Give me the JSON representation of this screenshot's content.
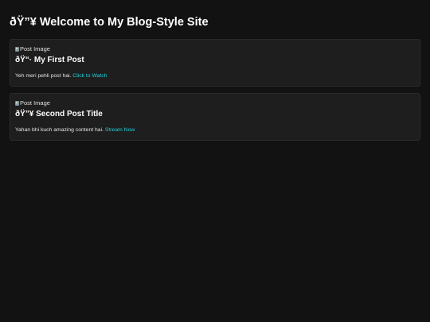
{
  "site": {
    "title": "ðŸ”¥ Welcome to My Blog-Style Site"
  },
  "posts": [
    {
      "image_alt": "Post Image",
      "title": "ðŸ“· My First Post",
      "body": "Yeh meri pehli post hai.",
      "link_label": "Click to Watch"
    },
    {
      "image_alt": "Post Image",
      "title": "ðŸ”¥ Second Post Title",
      "body": "Yahan bhi kuch amazing content hai.",
      "link_label": "Stream Now"
    }
  ],
  "colors": {
    "background": "#121212",
    "card": "#1e1e1e",
    "link": "#1fd3e0"
  },
  "icons": {
    "post_image": "broken-image-icon"
  }
}
